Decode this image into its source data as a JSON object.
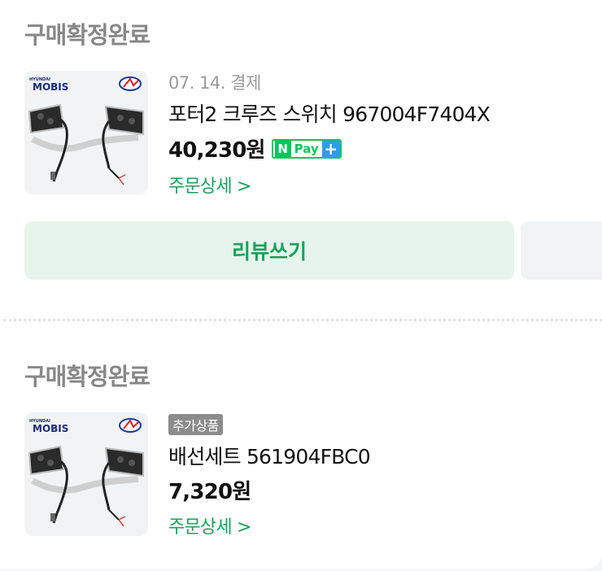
{
  "orders": [
    {
      "status": "구매확정완료",
      "thumb_brand": "MOBIS",
      "thumb_brand_top": "HYUNDAI",
      "date_label": "07. 14. 결제",
      "title": "포터2 크루즈 스위치 967004F7404X",
      "price": "40,230원",
      "npay": {
        "n": "N",
        "text": "Pay",
        "plus": "+"
      },
      "detail_link": "주문상세 >",
      "review_button": "리뷰쓰기"
    },
    {
      "status": "구매확정완료",
      "thumb_brand": "MOBIS",
      "thumb_brand_top": "HYUNDAI",
      "badge": "추가상품",
      "title": "배선세트 561904FBC0",
      "price": "7,320원",
      "detail_link": "주문상세 >"
    }
  ],
  "colors": {
    "accent": "#17a25c",
    "npay_green": "#03c75a",
    "npay_blue": "#2d9bf0"
  }
}
